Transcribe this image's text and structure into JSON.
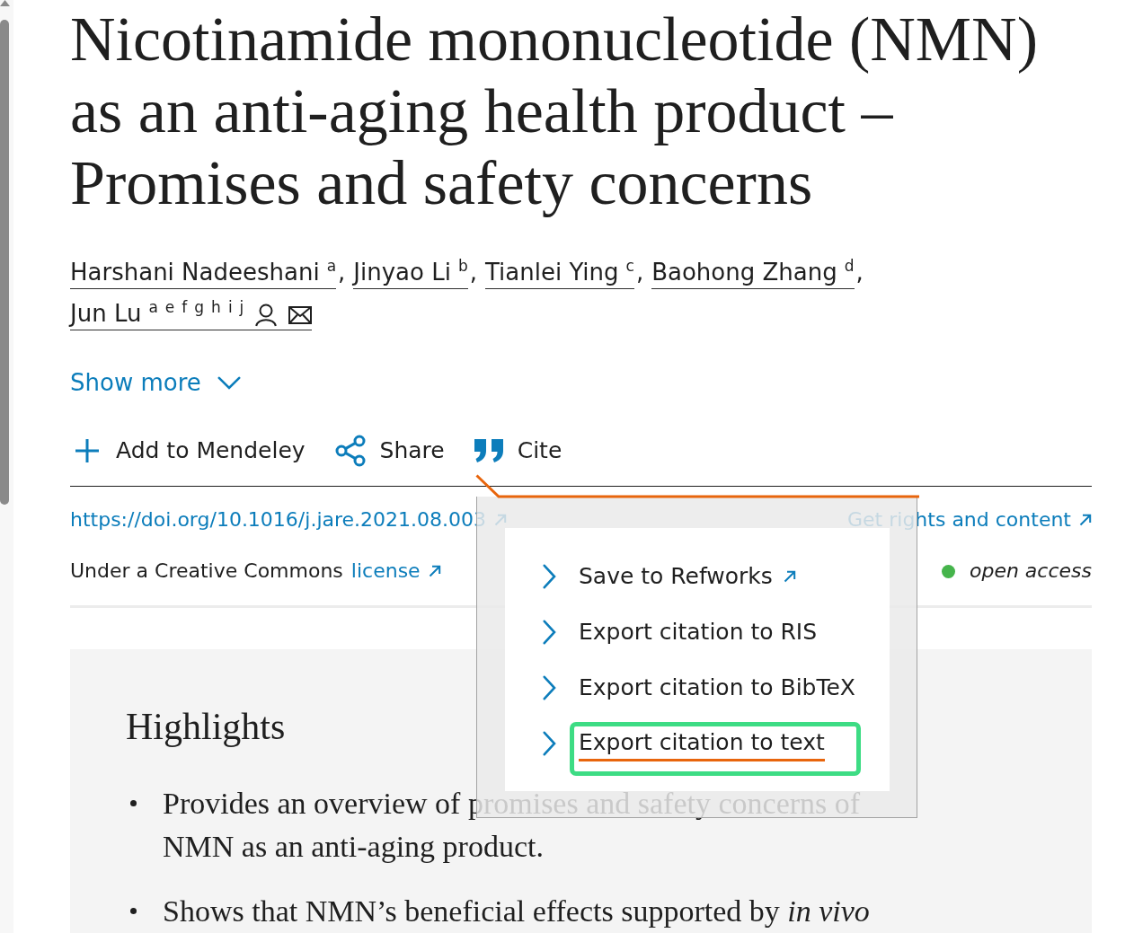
{
  "title": "Nicotinamide mononucleotide (NMN) as an anti-aging health product – Promises and safety concerns",
  "authors": [
    {
      "name": "Harshani Nadeeshani",
      "affiliations": [
        "a"
      ],
      "separator": ",",
      "corresponding": false,
      "email": false
    },
    {
      "name": "Jinyao Li",
      "affiliations": [
        "b"
      ],
      "separator": ",",
      "corresponding": false,
      "email": false
    },
    {
      "name": "Tianlei Ying",
      "affiliations": [
        "c"
      ],
      "separator": ",",
      "corresponding": false,
      "email": false
    },
    {
      "name": "Baohong Zhang",
      "affiliations": [
        "d"
      ],
      "separator": ",",
      "corresponding": false,
      "email": false
    },
    {
      "name": "Jun Lu",
      "affiliations": [
        "a",
        "e",
        "f",
        "g",
        "h",
        "i",
        "j"
      ],
      "corresponding": true,
      "email": true
    }
  ],
  "show_more": {
    "label": "Show more",
    "expanded": false
  },
  "actions": [
    {
      "kind": "add",
      "label": "Add to Mendeley"
    },
    {
      "kind": "share",
      "label": "Share"
    },
    {
      "kind": "cite",
      "label": "Cite"
    }
  ],
  "doi_link": "https://doi.org/10.1016/j.jare.2021.08.003",
  "rights_link": "Get rights and content",
  "license": {
    "text": "Under a Creative Commons",
    "link": "license"
  },
  "access_label": "open access",
  "highlights": {
    "heading": "Highlights",
    "items": [
      "Provides an overview of promises and safety concerns of NMN as an anti-aging product.",
      "Shows that NMN’s beneficial effects supported by *in vivo*"
    ]
  },
  "cite_menu": {
    "items": [
      {
        "label": "Save to Refworks",
        "external": true,
        "marked": false
      },
      {
        "label": "Export citation to RIS",
        "external": false,
        "marked": false
      },
      {
        "label": "Export citation to BibTeX",
        "external": false,
        "marked": false
      },
      {
        "label": "Export citation to text",
        "external": false,
        "marked": true
      }
    ]
  }
}
